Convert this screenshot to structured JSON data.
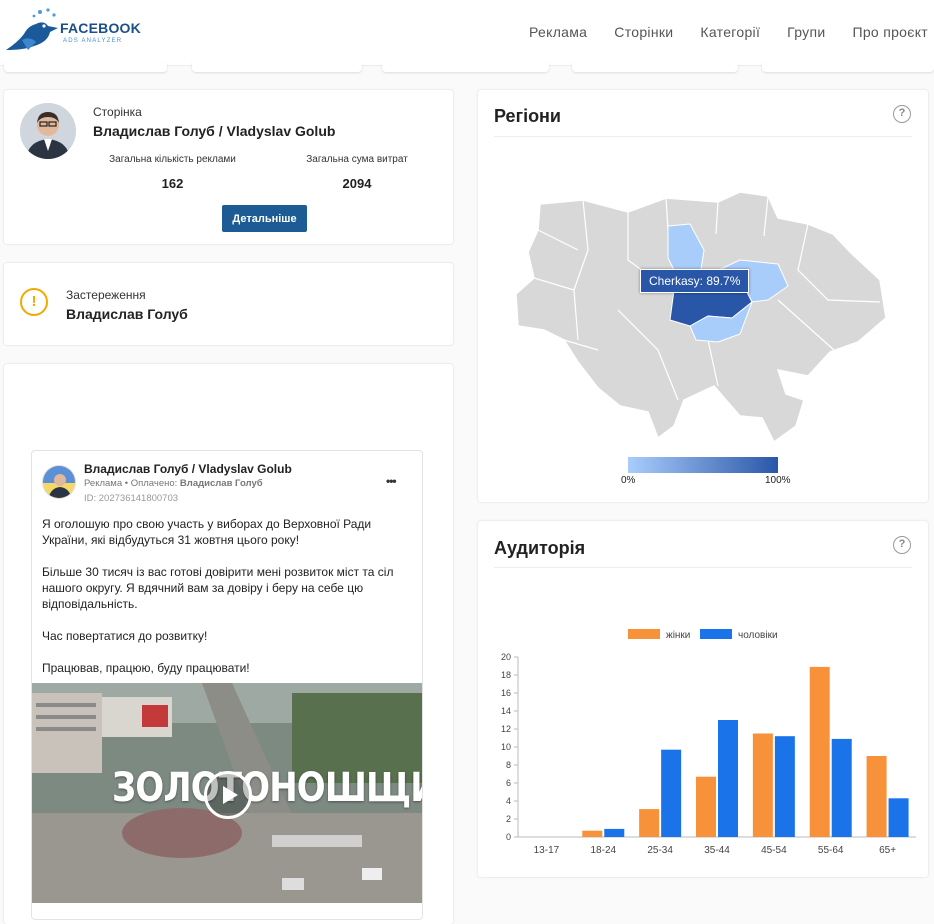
{
  "header": {
    "logo_text": "FACEBOOK",
    "logo_sub": "ADS ANALYZER",
    "nav": [
      "Реклама",
      "Сторінки",
      "Категорії",
      "Групи",
      "Про проєкт"
    ]
  },
  "page_card": {
    "label": "Сторінка",
    "name": "Владислав Голуб / Vladyslav Golub",
    "stat1_label": "Загальна кількість реклами",
    "stat1_value": "162",
    "stat2_label": "Загальна сума витрат",
    "stat2_value": "2094",
    "button": "Детальніше"
  },
  "warning_card": {
    "label": "Застереження",
    "name": "Владислав Голуб"
  },
  "post": {
    "author": "Владислав Голуб / Vladyslav Golub",
    "meta_ad": "Реклама",
    "meta_sep": " • Оплачено: ",
    "meta_paid": "Владислав Голуб",
    "id": "ID: 202736141800703",
    "more": "•••",
    "p1": "Я оголошую про свою участь у виборах до Верховної Ради України, які відбудуться 31 жовтня цього року!",
    "p2": "Більше 30 тисяч із вас готові довірити мені розвиток міст та сіл нашого округу. Я вдячний вам за довіру і беру на себе цю відповідальність.",
    "p3": "Час повертатися до розвитку!",
    "p4": "Працював, працюю, буду працювати!",
    "video_text": "ЗОЛОТОНОШЩИНА"
  },
  "regions": {
    "title": "Регіони",
    "help": "?",
    "tooltip": "Cherkasy: 89.7%",
    "legend_min": "0%",
    "legend_max": "100%",
    "color_low": "#a9cdfb",
    "color_high": "#2a56a8"
  },
  "audience": {
    "title": "Аудиторія",
    "help": "?",
    "legend_women": "жінки",
    "legend_men": "чоловіки",
    "color_women": "#f7923a",
    "color_men": "#1a73e8"
  },
  "chart_data": {
    "type": "bar",
    "categories": [
      "13-17",
      "18-24",
      "25-34",
      "35-44",
      "45-54",
      "55-64",
      "65+"
    ],
    "series": [
      {
        "name": "жінки",
        "values": [
          0,
          0.7,
          3.1,
          6.7,
          11.5,
          18.9,
          9.0
        ]
      },
      {
        "name": "чоловіки",
        "values": [
          0,
          0.9,
          9.7,
          13.0,
          11.2,
          10.9,
          4.3
        ]
      }
    ],
    "ylim": [
      0,
      20
    ],
    "yticks": [
      0,
      2,
      4,
      6,
      8,
      10,
      12,
      14,
      16,
      18,
      20
    ],
    "legend": "top-center",
    "grid": false
  }
}
